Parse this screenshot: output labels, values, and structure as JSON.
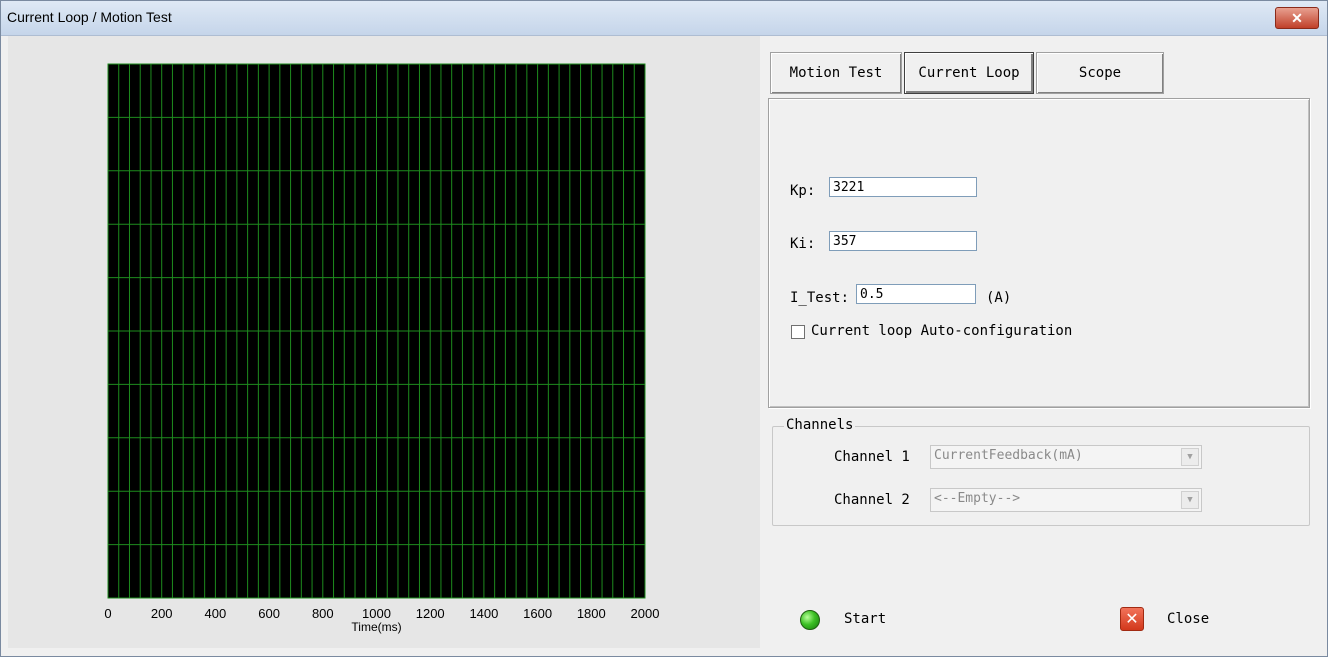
{
  "window": {
    "title": "Current Loop / Motion Test",
    "close_glyph": "✕"
  },
  "tabs": [
    {
      "label": "Motion Test",
      "active": false
    },
    {
      "label": "Current Loop",
      "active": true
    },
    {
      "label": "Scope",
      "active": false
    }
  ],
  "current_loop": {
    "kp_label": "Kp:",
    "kp_value": "3221",
    "ki_label": "Ki:",
    "ki_value": "357",
    "itest_label": "I_Test:",
    "itest_value": "0.5",
    "itest_unit": "(A)",
    "auto_config_label": "Current loop Auto-configuration",
    "auto_config_checked": false
  },
  "channels": {
    "title": "Channels",
    "ch1_label": "Channel 1",
    "ch1_value": "CurrentFeedback(mA)",
    "ch2_label": "Channel 2",
    "ch2_value": "<--Empty-->"
  },
  "buttons": {
    "start_label": "Start",
    "close_label": "Close"
  },
  "icons": {
    "start": "green-led-icon",
    "close": "red-x-icon",
    "dropdown": "chevron-down-icon"
  },
  "colors": {
    "plot_bg": "#000000",
    "grid": "#1e8c1e",
    "title_bar": "#cfdcee"
  },
  "chart_data": {
    "type": "line",
    "xlabel": "Time(ms)",
    "xlim": [
      0,
      2000
    ],
    "x_ticks": [
      0,
      200,
      400,
      600,
      800,
      1000,
      1200,
      1400,
      1600,
      1800,
      2000
    ],
    "series": [],
    "grid": true
  }
}
